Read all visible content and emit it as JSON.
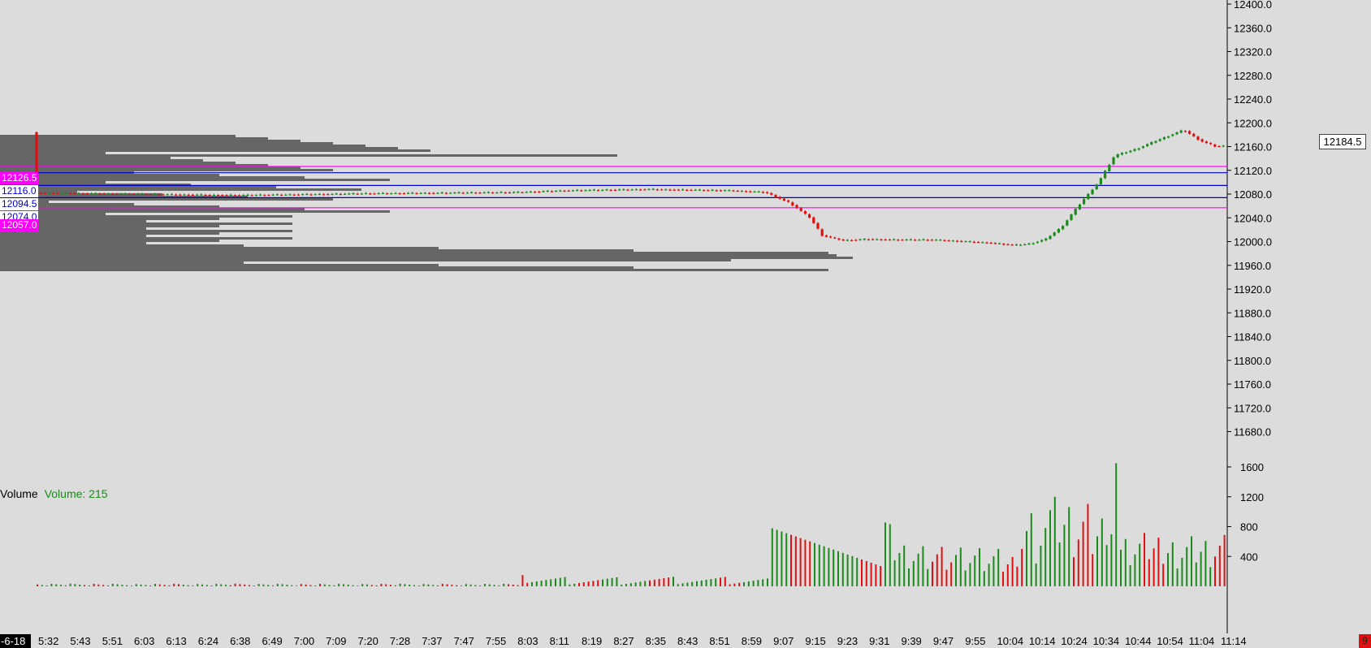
{
  "price_axis": {
    "labels": [
      "12400.0",
      "12360.0",
      "12320.0",
      "12280.0",
      "12240.0",
      "12200.0",
      "12160.0",
      "12120.0",
      "12080.0",
      "12040.0",
      "12000.0",
      "11960.0",
      "11920.0",
      "11880.0",
      "11840.0",
      "11800.0",
      "11760.0",
      "11720.0",
      "11680.0"
    ],
    "last_price": "12184.5"
  },
  "volume_axis": {
    "labels": [
      "1600",
      "1200",
      "800",
      "400"
    ]
  },
  "time_axis": {
    "date_label": "-6-18",
    "labels": [
      "5:32",
      "5:43",
      "5:51",
      "6:03",
      "6:13",
      "6:24",
      "6:38",
      "6:49",
      "7:00",
      "7:09",
      "7:20",
      "7:28",
      "7:37",
      "7:47",
      "7:55",
      "8:03",
      "8:11",
      "8:19",
      "8:27",
      "8:35",
      "8:43",
      "8:51",
      "8:59",
      "9:07",
      "9:15",
      "9:23",
      "9:31",
      "9:39",
      "9:47",
      "9:55",
      "10:04",
      "10:14",
      "10:24",
      "10:34",
      "10:44",
      "10:54",
      "11:04",
      "11:14"
    ]
  },
  "volume_panel": {
    "title": "Volume",
    "value_label": "Volume: 215"
  },
  "level_lines": [
    {
      "price": "12126.5",
      "color": "#ff00ff",
      "tag": "12126.5"
    },
    {
      "price": "12116.0",
      "color": "#0000cc",
      "tag": "12116.0"
    },
    {
      "price": "12094.5",
      "color": "#0000cc",
      "tag": "12094.5"
    },
    {
      "price": "12074.0",
      "color": "#0000cc",
      "tag": "12074.0"
    },
    {
      "price": "12057.0",
      "color": "#ff00ff",
      "tag": "12057.0"
    }
  ],
  "corner_badge": "9",
  "colors": {
    "up": "#1a8a1a",
    "down": "#e01010",
    "profile": "#666666",
    "background": "#dcdcdc"
  }
}
